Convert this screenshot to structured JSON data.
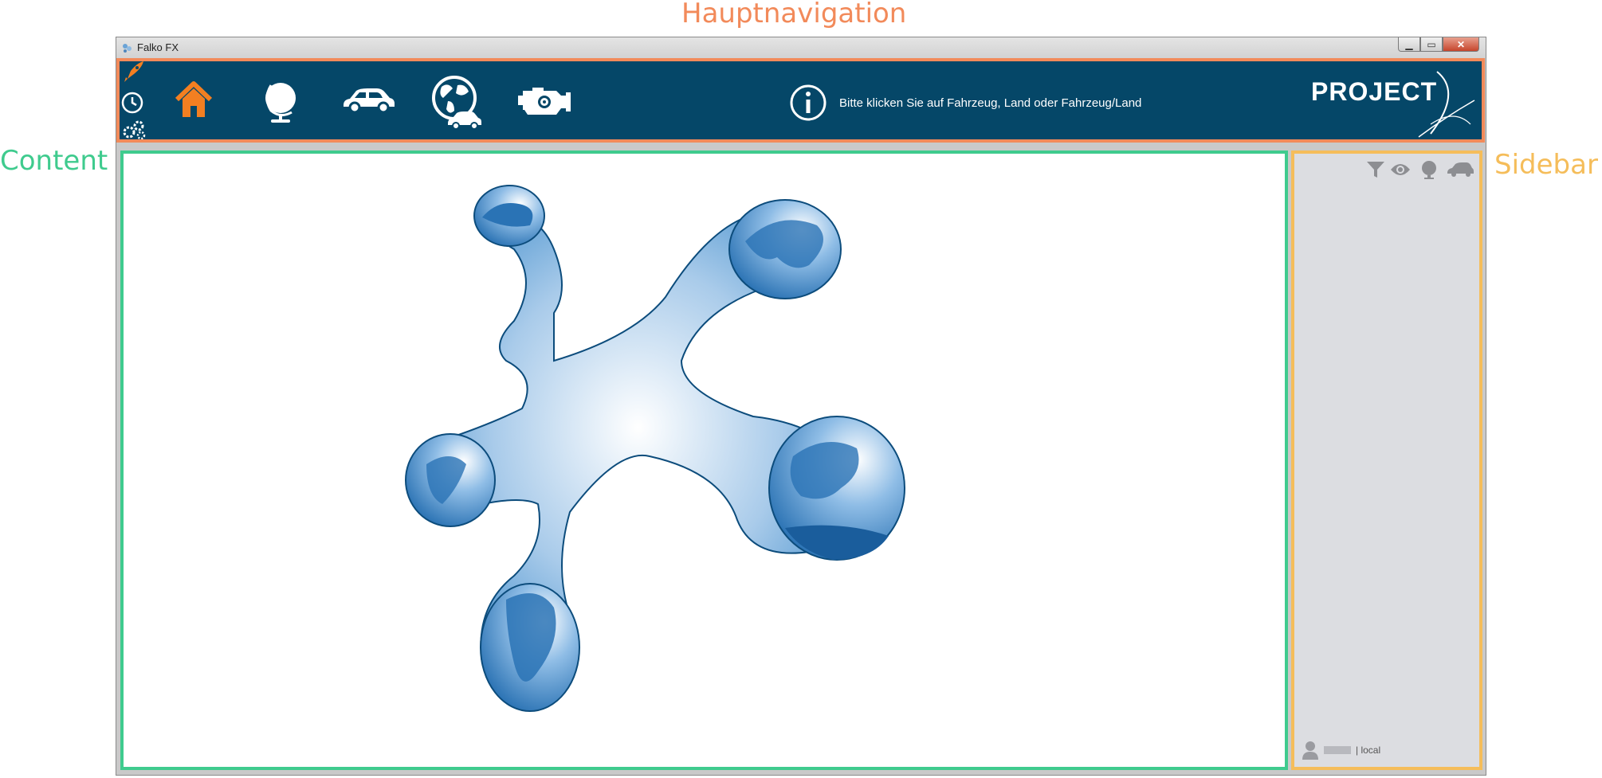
{
  "annotations": {
    "top": "Hauptnavigation",
    "left": "Content",
    "right": "Sidebar"
  },
  "window": {
    "title": "Falko FX",
    "controls": [
      "minimize",
      "maximize",
      "close"
    ]
  },
  "nav": {
    "small_icons": [
      "rocket-icon",
      "clock-icon",
      "gears-icon"
    ],
    "items": [
      {
        "name": "home-icon",
        "active": true
      },
      {
        "name": "globe-icon",
        "active": false
      },
      {
        "name": "car-icon",
        "active": false
      },
      {
        "name": "globe-car-icon",
        "active": false
      },
      {
        "name": "engine-gear-icon",
        "active": false
      }
    ],
    "info_text": "Bitte klicken Sie auf Fahrzeug, Land oder Fahrzeug/Land",
    "logo_text": "PROJECT"
  },
  "sidebar": {
    "tools": [
      "filter-icon",
      "eye-icon",
      "globe-icon",
      "car-icon"
    ],
    "user_suffix": "| local"
  },
  "colors": {
    "nav_bg": "#054768",
    "accent_active": "#f37f21",
    "highlight_nav": "#f28a5a",
    "highlight_content": "#3fcb8e",
    "highlight_sidebar": "#f5bd5a",
    "sidebar_bg": "#dcdde1",
    "globe_blue": "#3f8ccb"
  }
}
